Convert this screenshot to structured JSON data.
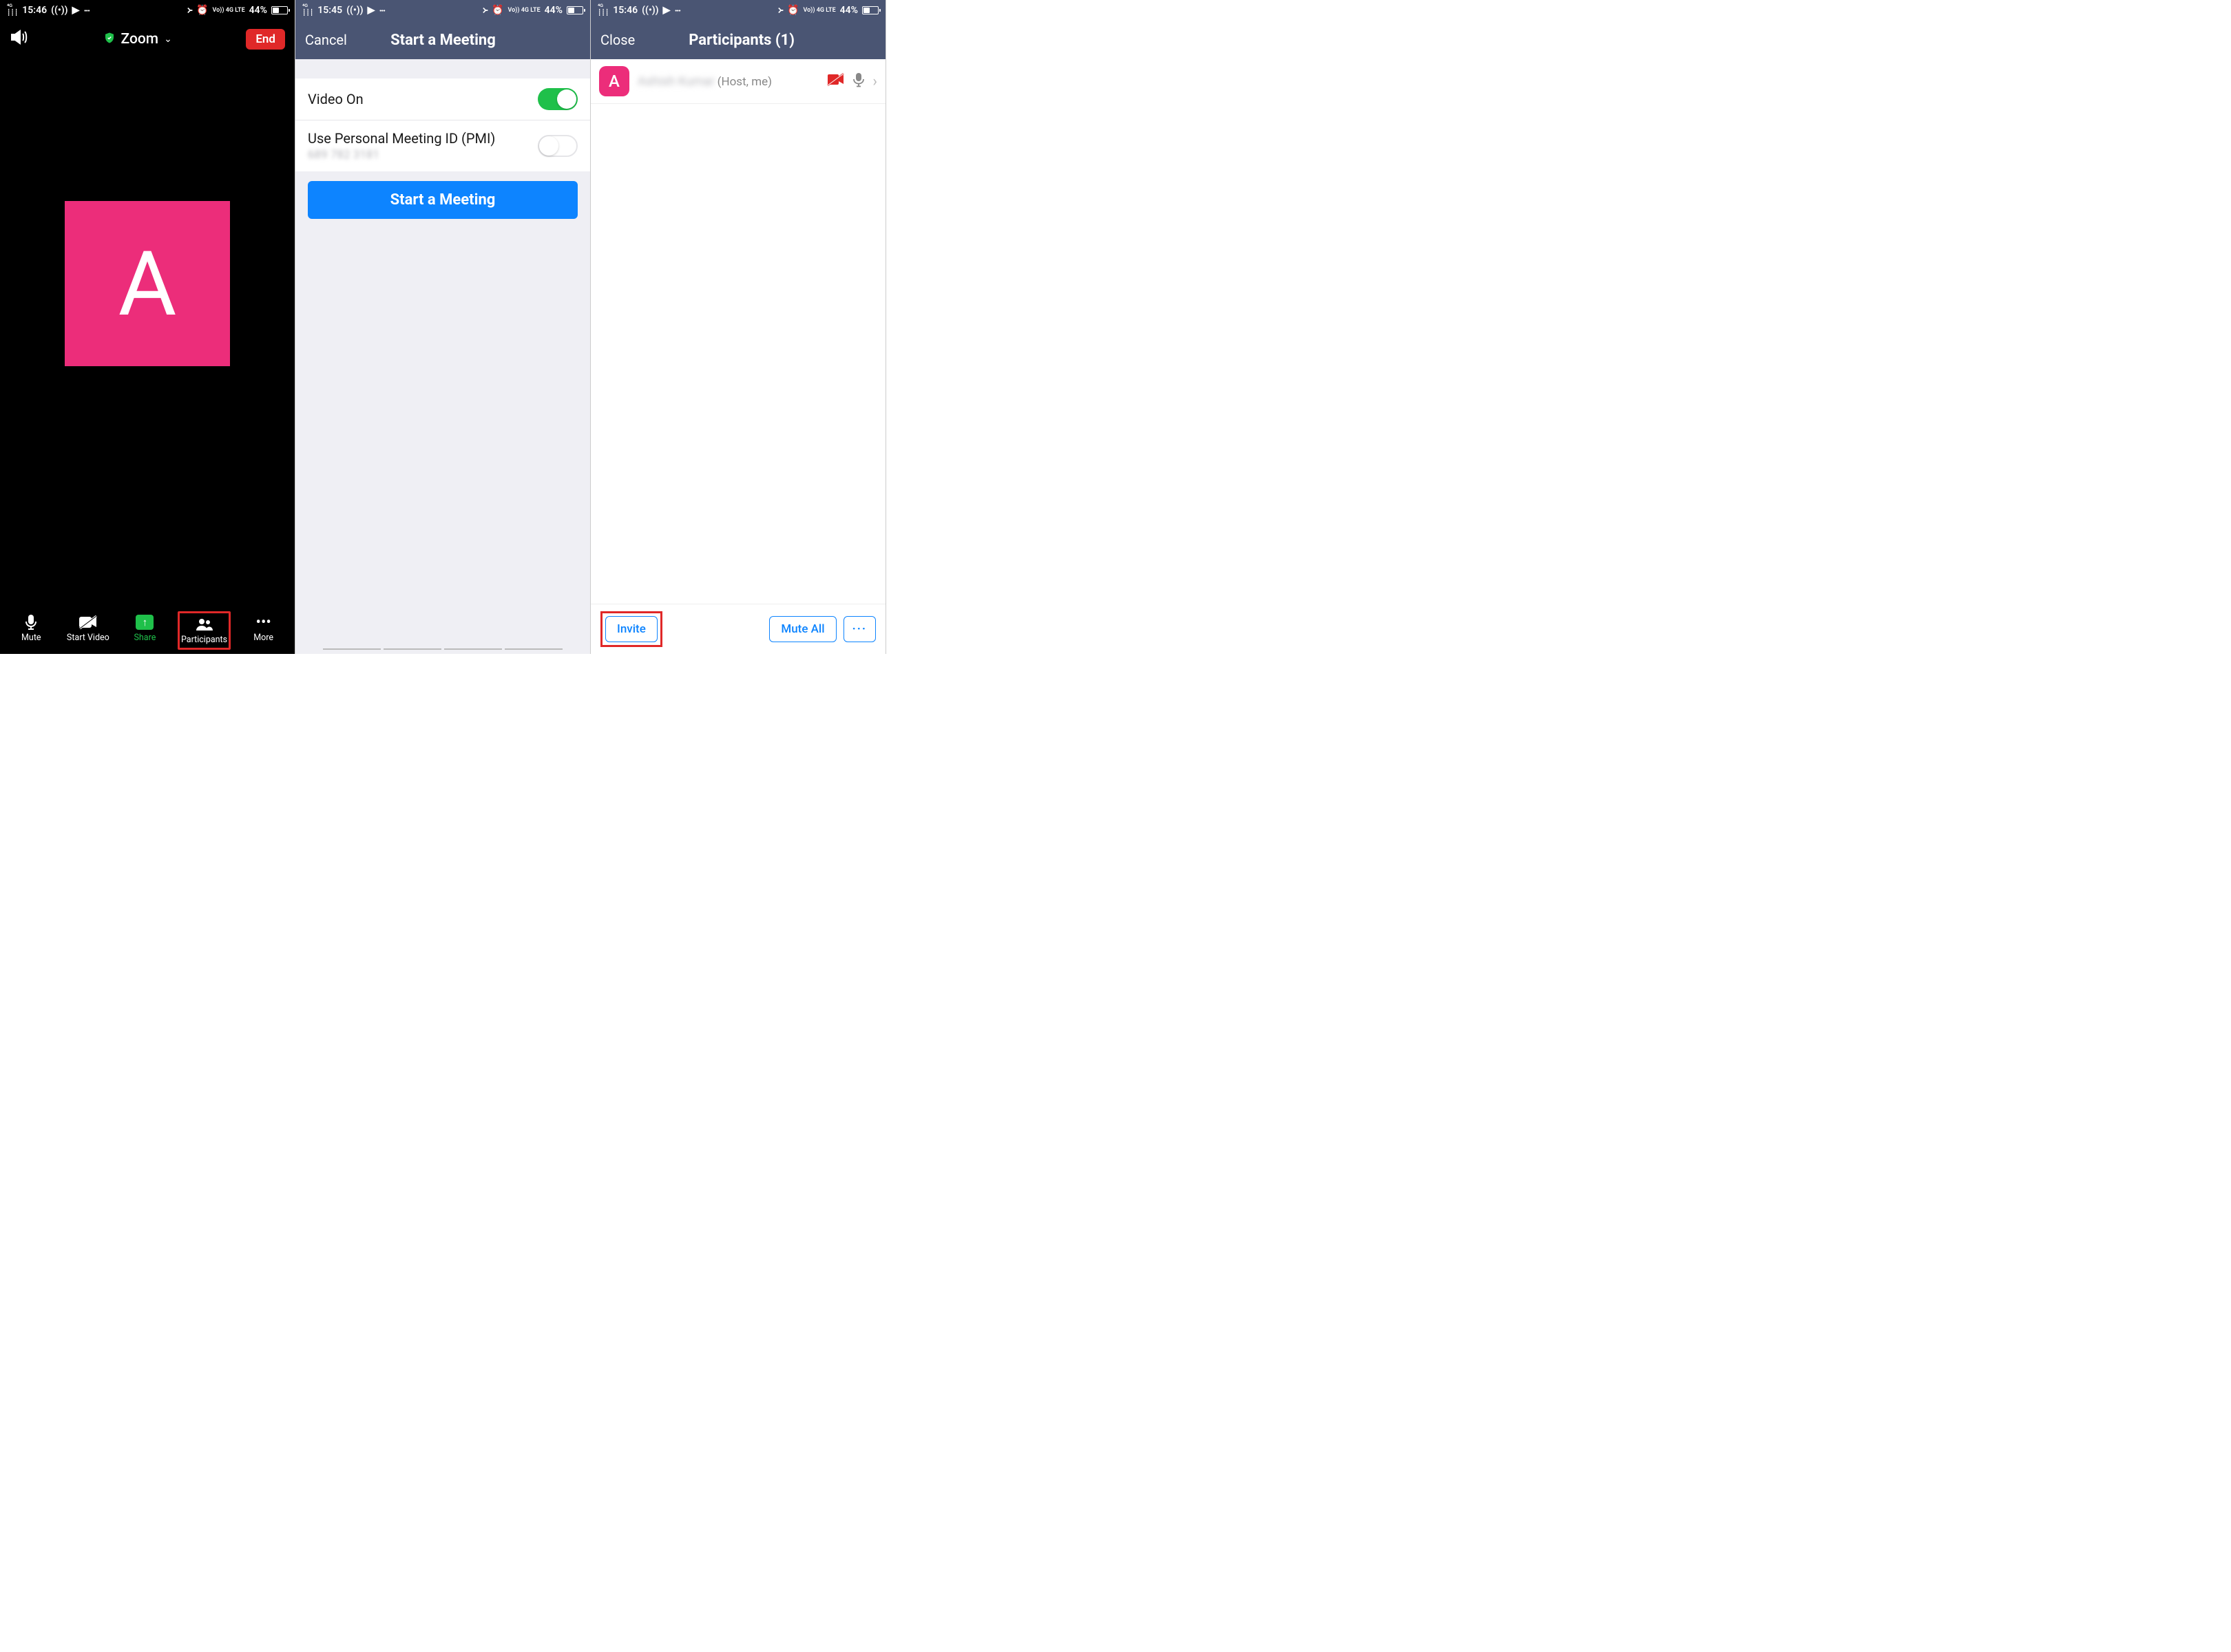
{
  "status": {
    "time_a": "15:46",
    "time_b": "15:45",
    "time_c": "15:46",
    "signal": "4G",
    "battery": "44%",
    "lte": "Vo)) 4G LTE"
  },
  "screen1": {
    "title": "Zoom",
    "end_button": "End",
    "avatar_letter": "A",
    "toolbar": {
      "mute": "Mute",
      "start_video": "Start Video",
      "share": "Share",
      "participants": "Participants",
      "more": "More"
    }
  },
  "screen2": {
    "cancel": "Cancel",
    "title": "Start a Meeting",
    "video_on": "Video On",
    "pmi_label": "Use Personal Meeting ID (PMI)",
    "pmi_value": "689 782 3181",
    "start_button": "Start a Meeting"
  },
  "screen3": {
    "close": "Close",
    "title": "Participants (1)",
    "participant": {
      "avatar": "A",
      "name": "Ashish Kumar",
      "role": "(Host, me)"
    },
    "invite": "Invite",
    "mute_all": "Mute All"
  }
}
